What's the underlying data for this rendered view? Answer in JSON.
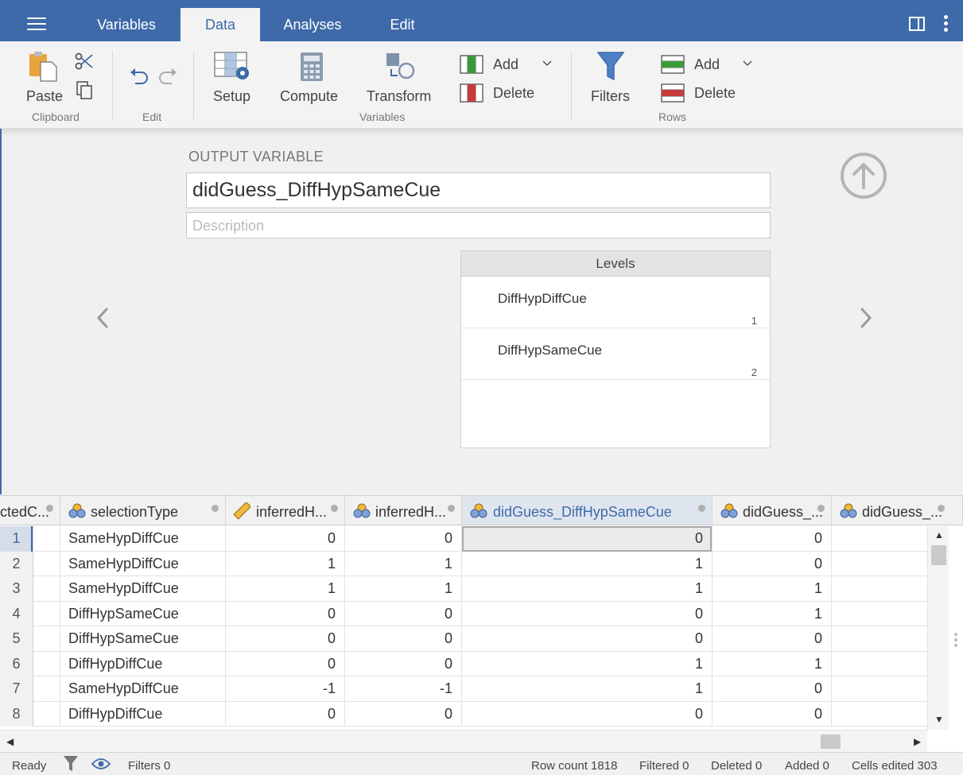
{
  "tabs": [
    {
      "label": "Variables"
    },
    {
      "label": "Data"
    },
    {
      "label": "Analyses"
    },
    {
      "label": "Edit"
    }
  ],
  "ribbon": {
    "paste": "Paste",
    "clipboard_group": "Clipboard",
    "edit_group": "Edit",
    "setup": "Setup",
    "compute": "Compute",
    "transform": "Transform",
    "var_add": "Add",
    "var_delete": "Delete",
    "variables_group": "Variables",
    "filters": "Filters",
    "row_add": "Add",
    "row_delete": "Delete",
    "rows_group": "Rows"
  },
  "editor": {
    "output_label": "OUTPUT VARIABLE",
    "name": "didGuess_DiffHypSameCue",
    "description_placeholder": "Description",
    "levels_title": "Levels",
    "levels": [
      {
        "name": "DiffHypDiffCue",
        "value": "1"
      },
      {
        "name": "DiffHypSameCue",
        "value": "2"
      }
    ]
  },
  "grid": {
    "columns": [
      {
        "label": "ctedC...",
        "icon": "none"
      },
      {
        "label": "selectionType",
        "icon": "nominal-icon"
      },
      {
        "label": "inferredH...",
        "icon": "ruler-icon"
      },
      {
        "label": "inferredH...",
        "icon": "nominal-icon"
      },
      {
        "label": "didGuess_DiffHypSameCue",
        "icon": "nominal-icon"
      },
      {
        "label": "didGuess_...",
        "icon": "nominal-icon"
      },
      {
        "label": "didGuess_...",
        "icon": "nominal-icon"
      }
    ],
    "rows": [
      {
        "n": "1",
        "type": "SameHypDiffCue",
        "a": "0",
        "b": "0",
        "c": "0",
        "d": "0"
      },
      {
        "n": "2",
        "type": "SameHypDiffCue",
        "a": "1",
        "b": "1",
        "c": "1",
        "d": "0"
      },
      {
        "n": "3",
        "type": "SameHypDiffCue",
        "a": "1",
        "b": "1",
        "c": "1",
        "d": "1"
      },
      {
        "n": "4",
        "type": "DiffHypSameCue",
        "a": "0",
        "b": "0",
        "c": "0",
        "d": "1"
      },
      {
        "n": "5",
        "type": "DiffHypSameCue",
        "a": "0",
        "b": "0",
        "c": "0",
        "d": "0"
      },
      {
        "n": "6",
        "type": "DiffHypDiffCue",
        "a": "0",
        "b": "0",
        "c": "1",
        "d": "1"
      },
      {
        "n": "7",
        "type": "SameHypDiffCue",
        "a": "-1",
        "b": "-1",
        "c": "1",
        "d": "0"
      },
      {
        "n": "8",
        "type": "DiffHypDiffCue",
        "a": "0",
        "b": "0",
        "c": "0",
        "d": "0"
      }
    ]
  },
  "status": {
    "ready": "Ready",
    "filters": "Filters 0",
    "row_count": "Row count 1818",
    "filtered": "Filtered 0",
    "deleted": "Deleted 0",
    "added": "Added 0",
    "cells_edited": "Cells edited 303"
  },
  "colors": {
    "brand": "#3e6aa9",
    "var_add_green": "#3a9a3a",
    "var_delete_red": "#c43c3c"
  }
}
